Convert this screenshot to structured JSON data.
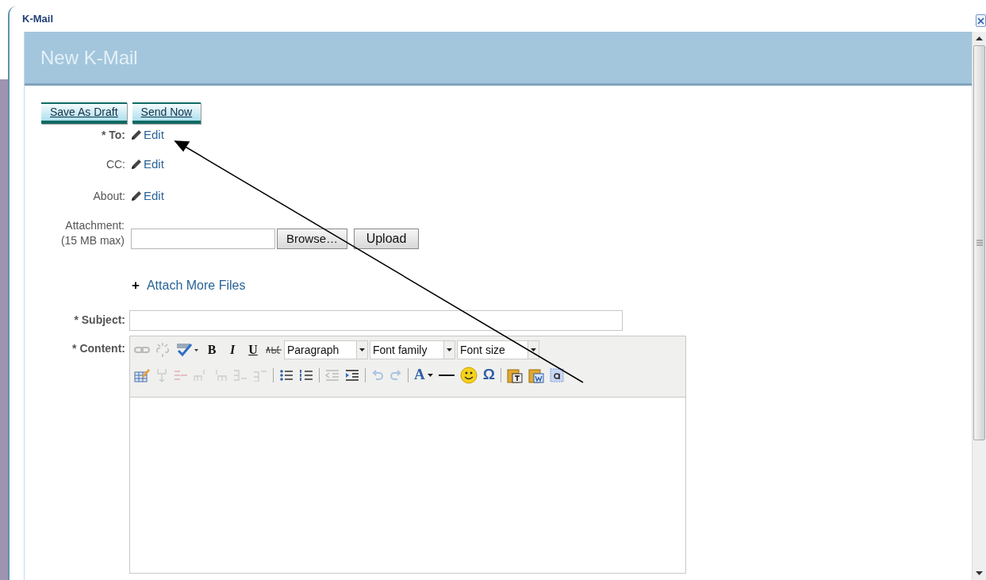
{
  "window": {
    "title": "K-Mail"
  },
  "header": {
    "title": "New K-Mail"
  },
  "actions": [
    "Save As Draft",
    "Send Now"
  ],
  "recipients": [
    {
      "label": "* To:",
      "link": "Edit"
    },
    {
      "label": "CC:",
      "link": "Edit"
    },
    {
      "label": "About:",
      "link": "Edit"
    }
  ],
  "attachment": {
    "label": "Attachment:",
    "note": "(15 MB max)",
    "buttons": [
      "Browse…",
      "Upload"
    ],
    "more_link": "Attach More Files",
    "plus": "+"
  },
  "subject": {
    "label": "* Subject:"
  },
  "content": {
    "label": "* Content:",
    "format_buttons": [
      "B",
      "I",
      "U"
    ],
    "selects": [
      "Paragraph",
      "Font family",
      "Font size"
    ],
    "text_color": "A",
    "special_char": "Ω"
  }
}
